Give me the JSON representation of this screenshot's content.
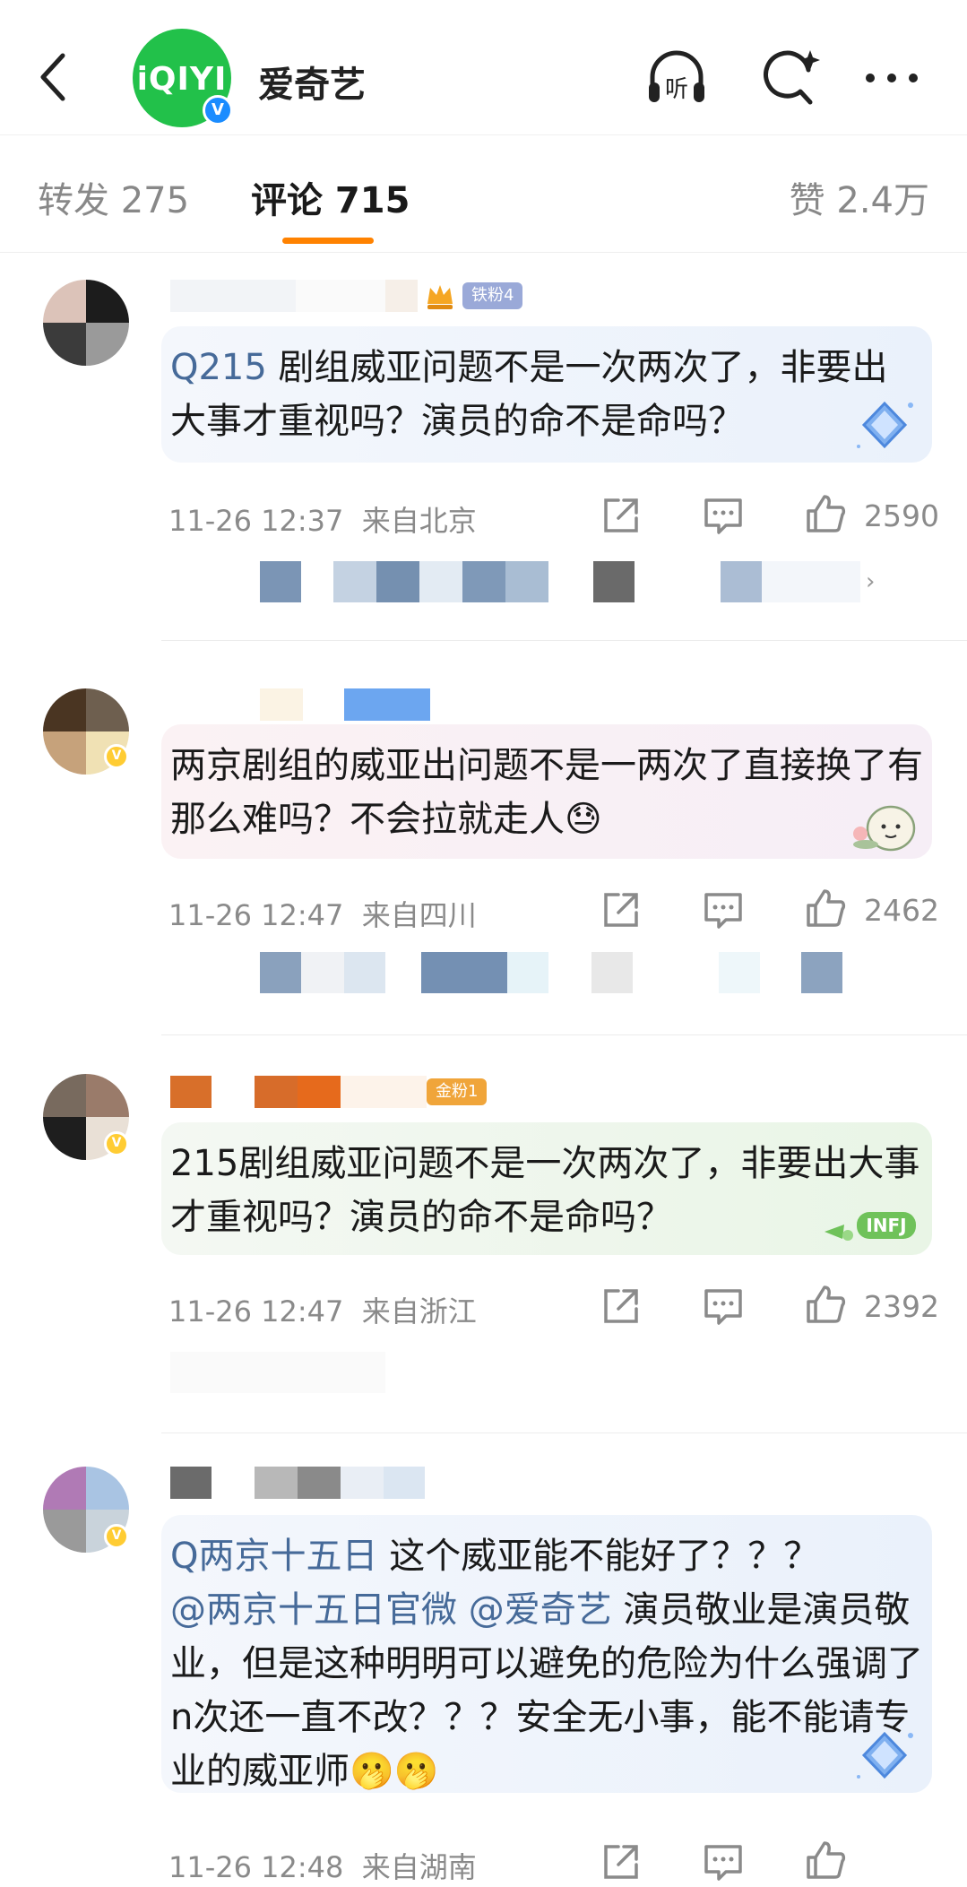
{
  "header": {
    "brand_logo_text": "iQIYI",
    "brand_name": "爱奇艺",
    "verified_mark": "V",
    "icons": [
      "back-icon",
      "listen-icon",
      "search-spark-icon",
      "more-icon"
    ],
    "listen_label": "听"
  },
  "tabs": {
    "repost": "转发 275",
    "comments": "评论 715",
    "likes": "赞 2.4万",
    "accent": "#ff8200"
  },
  "comments": [
    {
      "fan_badge": "铁粉4",
      "link": "Q215",
      "text": " 剧组威亚问题不是一次两次了，非要出大事才重视吗？演员的命不是命吗？",
      "time": "11-26 12:37",
      "location": "来自北京",
      "likes": "2590"
    },
    {
      "fan_badge": "",
      "link": "",
      "text": "两京剧组的威亚出问题不是一两次了直接换了有那么难吗？不会拉就走人😓",
      "time": "11-26 12:47",
      "location": "来自四川",
      "likes": "2462"
    },
    {
      "fan_badge": "金粉1",
      "link": "",
      "text": "215剧组威亚问题不是一次两次了，非要出大事才重视吗？演员的命不是命吗？",
      "time": "11-26 12:47",
      "location": "来自浙江",
      "likes": "2392"
    },
    {
      "fan_badge": "",
      "link": "Q两京十五日",
      "text_a": " 这个威亚能不能好了？？？",
      "mention1": "@两京十五日官微",
      "mention2": " @爱奇艺",
      "text_b": " 演员敬业是演员敬业，但是这种明明可以避免的危险为什么强调了n次还一直不改？？？安全无小事，能不能请专业的威亚师🫢🫢",
      "time": "11-26 12:48",
      "location": "来自湖南",
      "likes": ""
    }
  ]
}
